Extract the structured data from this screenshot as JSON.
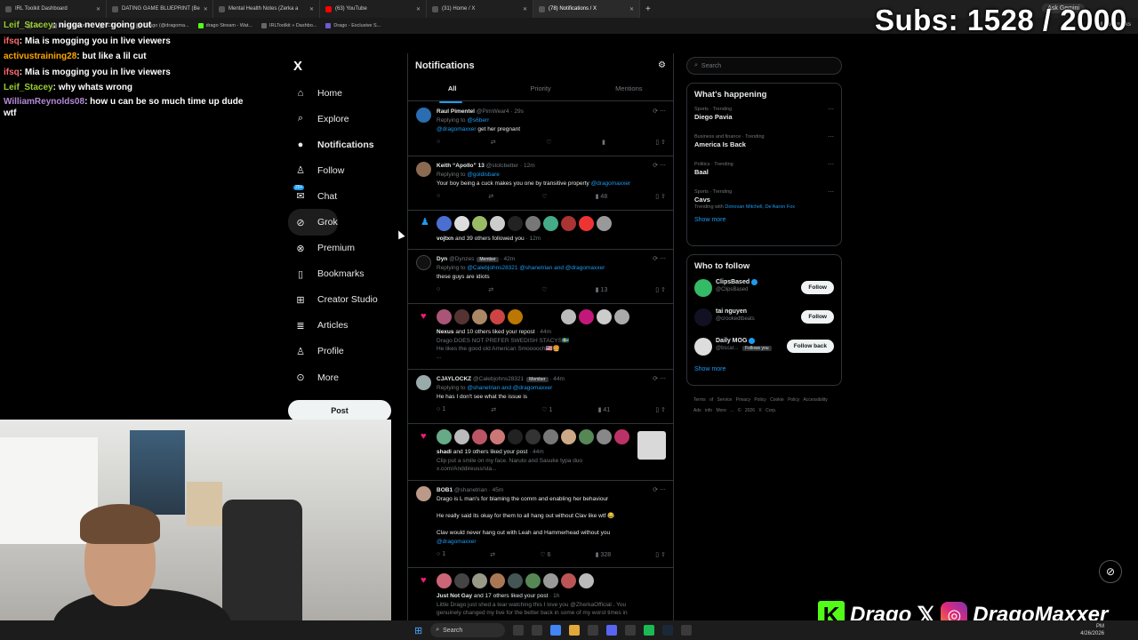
{
  "browser": {
    "tabs": [
      {
        "label": "IRL Toolkit Dashboard"
      },
      {
        "label": "DATING GAME BLUEPRINT (Be"
      },
      {
        "label": "Mental Health Notes (Zerka a"
      },
      {
        "label": "(63) YouTube"
      },
      {
        "label": "(31) Home / X"
      },
      {
        "label": "(78) Notifications / X"
      }
    ],
    "ask_gemini": "Ask Gemini",
    "bookmarks": [
      "edu",
      "work/personal",
      "ChatGPT",
      "Drago (@dragoma...",
      "drago Stream - Wat...",
      "IRLToolkit » Dashbo...",
      "Drago - Exclusive S..."
    ],
    "all_bookmarks": "All Bookmarks"
  },
  "overlay": {
    "subs": "Subs: 1528 / 2000",
    "chat": [
      {
        "user": "Leif_Stacey",
        "text": "nigga never going out"
      },
      {
        "user": "ifsq",
        "text": "Mia is mogging you in live viewers"
      },
      {
        "user": "activustraining28",
        "text": "but like a lil cut"
      },
      {
        "user": "ifsq",
        "text": "Mia is mogging you in live viewers"
      },
      {
        "user": "Leif_Stacey",
        "text": "why whats wrong"
      },
      {
        "user": "WilliamReynolds08",
        "text": "how u can be so much time up dude wtf"
      }
    ],
    "socials": {
      "kick": "Drago",
      "instagram": "DragoMaxxer"
    }
  },
  "left_nav": {
    "logo": "X",
    "items": [
      {
        "label": "Home",
        "icon": "home-icon",
        "glyph": "⌂"
      },
      {
        "label": "Explore",
        "icon": "search-icon",
        "glyph": "⌕"
      },
      {
        "label": "Notifications",
        "icon": "bell-icon",
        "glyph": "🔔"
      },
      {
        "label": "Follow",
        "icon": "follow-icon",
        "glyph": "♙"
      },
      {
        "label": "Chat",
        "icon": "chat-icon",
        "glyph": "✉"
      },
      {
        "label": "Grok",
        "icon": "grok-icon",
        "glyph": "⊘"
      },
      {
        "label": "Premium",
        "icon": "premium-icon",
        "glyph": "⊗"
      },
      {
        "label": "Bookmarks",
        "icon": "bookmark-icon",
        "glyph": "▯"
      },
      {
        "label": "Creator Studio",
        "icon": "creator-icon",
        "glyph": "⊞"
      },
      {
        "label": "Articles",
        "icon": "articles-icon",
        "glyph": "≣"
      },
      {
        "label": "Profile",
        "icon": "profile-icon",
        "glyph": "♙"
      },
      {
        "label": "More",
        "icon": "more-icon",
        "glyph": "⊙"
      }
    ],
    "chat_badge": "20+",
    "post_label": "Post"
  },
  "notifications": {
    "title": "Notifications",
    "tabs": [
      "All",
      "Priority",
      "Mentions"
    ],
    "items": [
      {
        "type": "reply",
        "name": "Raul Pimentel",
        "handle": "@PimWear4",
        "time": "29s",
        "replying": "@s6berr",
        "body_link": "@dragomaxxer",
        "body": "get her pregnant",
        "counts": [
          "",
          "",
          "",
          ""
        ]
      },
      {
        "type": "reply",
        "name": "Keith “Apollo” 13",
        "handle": "@stolcbetter",
        "time": "12m",
        "replying": "@goldisbare",
        "body": "Your boy being a cuck makes you one by transitive property",
        "body_link": "@dragomaxxer",
        "counts": [
          "",
          "",
          "",
          "48"
        ]
      },
      {
        "type": "follow",
        "text_bold": "vojtxn",
        "text": "and 39 others followed you",
        "time": "12m"
      },
      {
        "type": "reply",
        "name": "Dyn",
        "handle": "@Dynzes",
        "member": "Member",
        "time": "42m",
        "replying": "@Calebjohns28321 @shanetrian and @dragomaxxer",
        "body": "these guys are idiots",
        "counts": [
          "",
          "",
          "",
          "13"
        ]
      },
      {
        "type": "like",
        "text_bold": "Nexus",
        "text": "and 10 others liked your repost",
        "time": "44m",
        "preview": [
          "Drago DOES NOT PREFER SWEDISH STACYS🇸🇪",
          "He likes the good old American Smooooch🇺🇸🍔",
          "..."
        ]
      },
      {
        "type": "reply",
        "name": "CJAYLOCKZ",
        "handle": "@Calebjohns28321",
        "member": "Member",
        "time": "44m",
        "replying": "@shanetrian and @dragomaxxer",
        "body": "He has I don't see what the issue is",
        "counts": [
          "1",
          "",
          "1",
          "41"
        ]
      },
      {
        "type": "like",
        "text_bold": "shadi",
        "text": "and 19 others liked your post",
        "time": "44m",
        "preview": [
          "Clip put a smile on my face. Naruto and Sasuke typa duo",
          "x.com/Anddireuss/sta..."
        ]
      },
      {
        "type": "reply",
        "name": "BOB1",
        "handle": "@shanetrian",
        "time": "45m",
        "body": "Drago is L man's for blaming the comm and enabling her behaviour",
        "body2": "He really said its okay for them to all hang out without Clav like wtf 😂",
        "body3": "Clav would never hang out with Leah and Hammerhead without you",
        "body_link": "@dragomaxxer",
        "counts": [
          "1",
          "",
          "6",
          "328"
        ]
      },
      {
        "type": "like",
        "text_bold": "Just Not Gay",
        "text": "and 17 others liked your post",
        "time": "1h",
        "preview": [
          "Little Drago just shed a tear watching this I love you @ZherkaOfficial . You",
          "genuinely changed my live for the better back in some of my worst times in"
        ]
      }
    ]
  },
  "right": {
    "search_placeholder": "Search",
    "happening_title": "What's happening",
    "trends": [
      {
        "cat": "Sports · Trending",
        "name": "Diego Pavia",
        "sub": ""
      },
      {
        "cat": "Business and finance · Trending",
        "name": "America Is Back",
        "sub": ""
      },
      {
        "cat": "Politics · Trending",
        "name": "Baal",
        "sub": ""
      },
      {
        "cat": "Sports · Trending",
        "name": "Cavs",
        "sub": "Trending with",
        "sub_link": "Donovan Mitchell, De'Aaron Fox"
      }
    ],
    "show_more": "Show more",
    "wtf_title": "Who to follow",
    "wtf": [
      {
        "name": "ClipsBased",
        "handle": "@ClipsBased",
        "verified": true,
        "button": "Follow",
        "followsyou": ""
      },
      {
        "name": "tai nguyen",
        "handle": "@crookedtbeats",
        "verified": false,
        "button": "Follow",
        "followsyou": ""
      },
      {
        "name": "Daily MOG",
        "handle": "@bscar...",
        "verified": true,
        "button": "Follow back",
        "followsyou": "Follows you"
      }
    ],
    "footer": "Terms of Service  Privacy Policy  Cookie Policy  Accessibility  Ads info  More ...  © 2026 X Corp."
  },
  "taskbar": {
    "search": "Search",
    "time": "PM",
    "date": "4/26/2026"
  }
}
